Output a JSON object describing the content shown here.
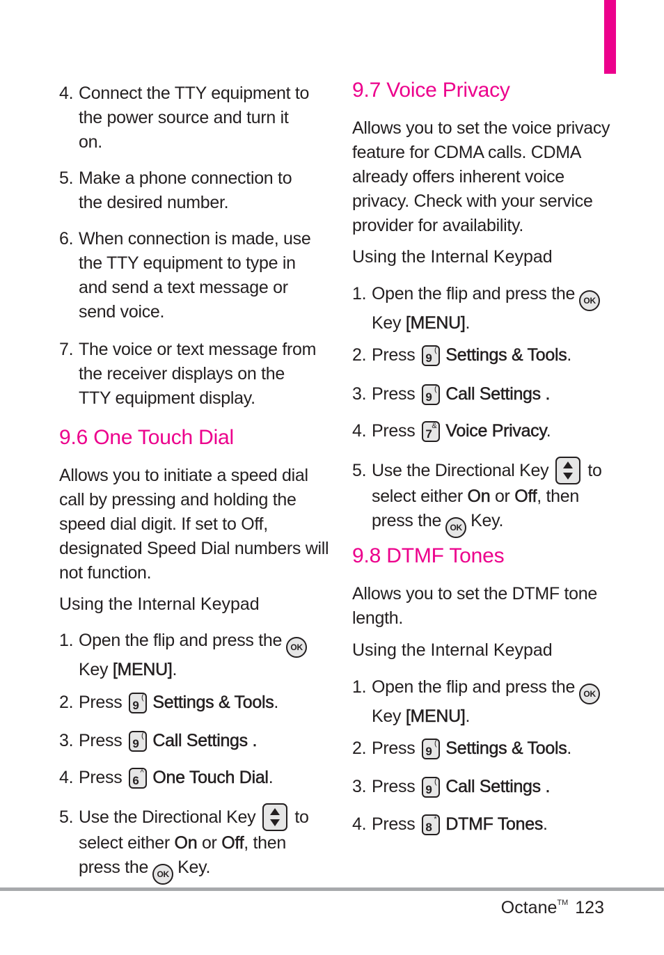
{
  "accent_color": "#ec008c",
  "left": {
    "steps_top": [
      {
        "num": "4.",
        "lines": [
          "Connect the TTY equipment to",
          "the power source and turn it",
          "on."
        ]
      },
      {
        "num": "5.",
        "lines": [
          "Make a phone connection to",
          "the desired number."
        ]
      },
      {
        "num": "6.",
        "lines": [
          "When connection is made, use",
          "the TTY equipment to type in",
          "and send a text message or",
          "send voice."
        ]
      },
      {
        "num": "7.",
        "lines": [
          "The voice or text message from",
          "the receiver displays on the",
          "TTY equipment display."
        ]
      }
    ],
    "section": {
      "heading": "9.6 One Touch Dial",
      "intro": [
        "Allows you to initiate a speed dial",
        "call by pressing and holding the",
        "speed dial digit. If set to Off,",
        "designated Speed Dial numbers will",
        "not function."
      ],
      "subheading": "Using the Internal Keypad",
      "step1": {
        "num": "1.",
        "text_a": "Open the flip and press the",
        "key_icon": "OK",
        "text_b": "Key",
        "menu": "[MENU]",
        "end": "."
      },
      "step2": {
        "num": "2.",
        "press": "Press",
        "key_digit": "9",
        "key_sym": "(",
        "label": "Settings & Tools",
        "end": "."
      },
      "step3": {
        "num": "3.",
        "press": "Press",
        "key_digit": "9",
        "key_sym": "(",
        "label": "Call Settings .",
        "end": ""
      },
      "step4": {
        "num": "4.",
        "press": "Press",
        "key_digit": "6",
        "key_sym": "^",
        "label": "One Touch Dial",
        "end": "."
      },
      "step5": {
        "num": "5.",
        "text_a": "Use the Directional Key",
        "text_b": "to",
        "line2_a": "select either",
        "on": "On",
        "or": "or",
        "off": "Off",
        "line2_b": ", then",
        "line3_a": "press the",
        "ok": "OK",
        "line3_b": "Key."
      }
    }
  },
  "right": {
    "s97": {
      "heading": "9.7 Voice Privacy",
      "intro": [
        "Allows you to set the voice privacy",
        "feature for CDMA calls. CDMA",
        "already offers inherent voice",
        "privacy. Check with your service",
        "provider for availability."
      ],
      "subheading": "Using the Internal Keypad",
      "step1": {
        "num": "1.",
        "text_a": "Open the flip and press the",
        "key_icon": "OK",
        "text_b": "Key",
        "menu": "[MENU]",
        "end": "."
      },
      "step2": {
        "num": "2.",
        "press": "Press",
        "key_digit": "9",
        "key_sym": "(",
        "label": "Settings & Tools",
        "end": "."
      },
      "step3": {
        "num": "3.",
        "press": "Press",
        "key_digit": "9",
        "key_sym": "(",
        "label": "Call Settings .",
        "end": ""
      },
      "step4": {
        "num": "4.",
        "press": "Press",
        "key_digit": "7",
        "key_sym": "&",
        "label": "Voice Privacy",
        "end": "."
      },
      "step5": {
        "num": "5.",
        "text_a": "Use the Directional Key",
        "text_b": "to",
        "line2_a": "select either",
        "on": "On",
        "or": "or",
        "off": "Off",
        "line2_b": ", then",
        "line3_a": "press the",
        "ok": "OK",
        "line3_b": "Key."
      }
    },
    "s98": {
      "heading": "9.8 DTMF Tones",
      "intro": [
        "Allows you to set the DTMF tone",
        "length."
      ],
      "subheading": "Using the Internal Keypad",
      "step1": {
        "num": "1.",
        "text_a": "Open the flip and press the",
        "key_icon": "OK",
        "text_b": "Key",
        "menu": "[MENU]",
        "end": "."
      },
      "step2": {
        "num": "2.",
        "press": "Press",
        "key_digit": "9",
        "key_sym": "(",
        "label": "Settings & Tools",
        "end": "."
      },
      "step3": {
        "num": "3.",
        "press": "Press",
        "key_digit": "9",
        "key_sym": "(",
        "label": "Call Settings .",
        "end": ""
      },
      "step4": {
        "num": "4.",
        "press": "Press",
        "key_digit": "8",
        "key_sym": "*",
        "label": "DTMF Tones",
        "end": "."
      }
    }
  },
  "footer": {
    "product": "Octane",
    "trademark": "TM",
    "page": "123"
  }
}
